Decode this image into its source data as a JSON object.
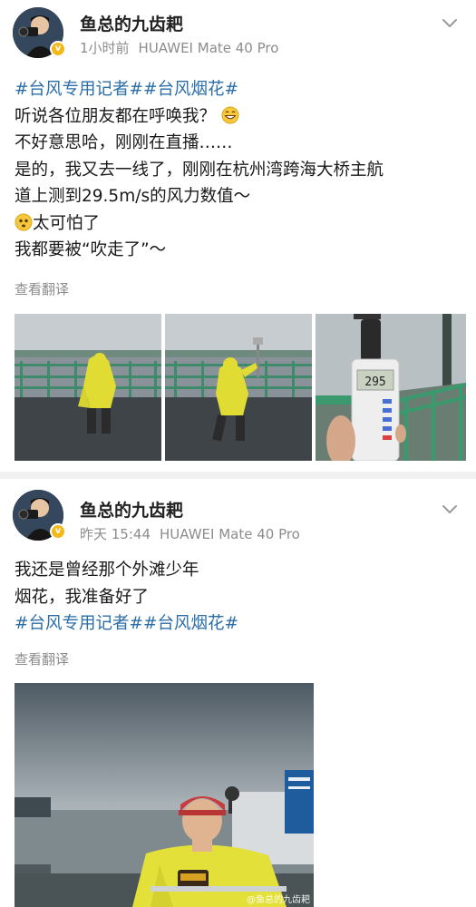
{
  "posts": [
    {
      "username": "鱼总的九齿耙",
      "time": "1小时前",
      "device": "HUAWEI Mate 40 Pro",
      "hashtags": "#台风专用记者##台风烟花#",
      "lines": [
        "听说各位朋友都在呼唤我？",
        "不好意思哈，刚刚在直播……",
        "是的，我又去一线了，刚刚在杭州湾跨海大桥主航",
        "道上测到29.5m/s的风力数值～",
        "太可怕了",
        "我都要被“吹走了”～"
      ],
      "translate": "查看翻译",
      "photos": [
        {
          "icon": "reporter-on-bridge-photo"
        },
        {
          "icon": "reporter-in-wind-photo"
        },
        {
          "icon": "anemometer-photo",
          "reading": "295"
        }
      ]
    },
    {
      "username": "鱼总的九齿耙",
      "time": "昨天 15:44",
      "device": "HUAWEI Mate 40 Pro",
      "lines": [
        "我还是曾经那个外滩少年",
        "烟花，我准备好了"
      ],
      "hashtags": "#台风专用记者##台风烟花#",
      "translate": "查看翻译",
      "photo_watermark": "@鱼总的九齿耙"
    }
  ],
  "colors": {
    "hashtag": "#2b6ea8",
    "meta": "#8c8c8c",
    "badge": "#f5b819",
    "raincoat": "#e6e03a"
  }
}
